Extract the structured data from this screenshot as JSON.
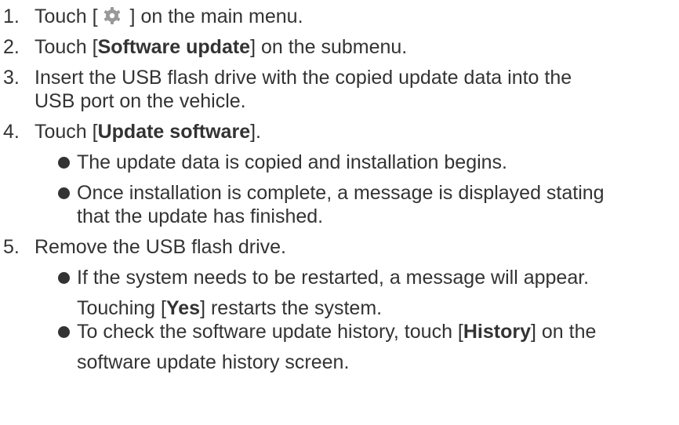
{
  "steps": [
    {
      "number": "1.",
      "pre": "Touch [",
      "icon": "settings-gear-icon",
      "post": " ] on the main menu."
    },
    {
      "number": "2.",
      "pre": "Touch [",
      "bold": "Software update",
      "post": "] on the submenu."
    },
    {
      "number": "3.",
      "line1": "Insert the USB flash drive with the copied update data into the",
      "line2": "USB port on the vehicle."
    },
    {
      "number": "4.",
      "pre": "Touch [",
      "bold": "Update software",
      "post": "].",
      "bullets": [
        {
          "line1": "The update data is copied and installation begins."
        },
        {
          "line1": "Once installation is complete, a message is displayed stating",
          "line2": "that the update has finished."
        }
      ]
    },
    {
      "number": "5.",
      "text": "Remove the USB flash drive.",
      "bullets": [
        {
          "line1": "If the system needs to be restarted, a message will appear.",
          "line2_pre": "Touching [",
          "line2_bold": "Yes",
          "line2_post": "] restarts the system."
        },
        {
          "line1_pre": "To check the software update history, touch [",
          "line1_bold": "History",
          "line1_post": "] on the",
          "line2": "software update history screen."
        }
      ]
    }
  ],
  "colors": {
    "text": "#333333",
    "icon": "#999999"
  }
}
